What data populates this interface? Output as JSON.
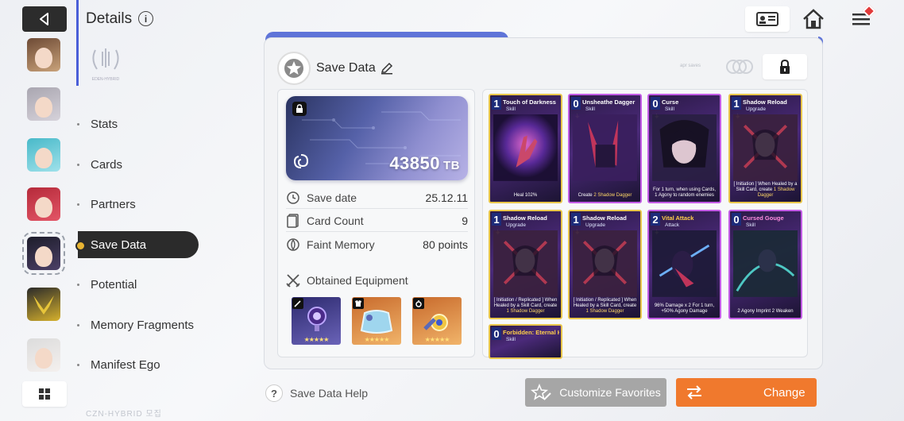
{
  "header": {
    "title": "Details",
    "info_icon": "i"
  },
  "emblem_text": "EDEN-HYBRID",
  "bottom_watermark": "CZN-HYBRID 모집",
  "nav": {
    "items": [
      {
        "label": "Stats"
      },
      {
        "label": "Cards"
      },
      {
        "label": "Partners"
      },
      {
        "label": "Save Data",
        "active": true
      },
      {
        "label": "Potential"
      },
      {
        "label": "Memory Fragments"
      },
      {
        "label": "Manifest Ego"
      }
    ]
  },
  "panel": {
    "title": "Save Data",
    "small_label": "apr saves"
  },
  "save_chip": {
    "value": "43850",
    "unit": "TB"
  },
  "stats": {
    "save_date": {
      "label": "Save date",
      "value": "25.12.11"
    },
    "card_count": {
      "label": "Card Count",
      "value": "9"
    },
    "faint_memory": {
      "label": "Faint Memory",
      "value": "80 points"
    }
  },
  "equipment": {
    "title": "Obtained Equipment",
    "items": [
      {
        "slot_icon": "sword-icon",
        "stars": "★★★★★"
      },
      {
        "slot_icon": "armor-icon",
        "stars": "★★★★★"
      },
      {
        "slot_icon": "ring-icon",
        "stars": "★★★★★"
      }
    ]
  },
  "cards": [
    {
      "cost": "1",
      "name": "Touch of Darkness",
      "type": "Skill",
      "desc": "Heal 102%"
    },
    {
      "cost": "0",
      "name": "Unsheathe Dagger",
      "type": "Skill",
      "desc_parts": [
        "Create ",
        "2 Shadow Dagger",
        ""
      ]
    },
    {
      "cost": "0",
      "name": "Curse",
      "type": "Skill",
      "desc": "For 1 turn, when using Cards, 1 Agony to random enemies"
    },
    {
      "cost": "1",
      "name": "Shadow Reload",
      "type": "Upgrade",
      "desc_parts": [
        "[ Initiation ] When Healed by a Skill Card, create ",
        "1 Shadow Dagger",
        ""
      ]
    },
    {
      "cost": "1",
      "name": "Shadow Reload",
      "type": "Upgrade",
      "desc_parts": [
        "[ Initiation / Replicated ] When Healed by a Skill Card, create ",
        "1 Shadow Dagger",
        ""
      ]
    },
    {
      "cost": "1",
      "name": "Shadow Reload",
      "type": "Upgrade",
      "desc_parts": [
        "[ Initiation / Replicated ] When Healed by a Skill Card, create ",
        "1 Shadow Dagger",
        ""
      ]
    },
    {
      "cost": "2",
      "name": "Vital Attack",
      "type": "Attack",
      "desc": "96% Damage x 2 For 1 turn, +50% Agony Damage"
    },
    {
      "cost": "0",
      "name": "Cursed Gouge",
      "type": "Skill",
      "desc": "2 Agony Imprint 2 Weaken"
    },
    {
      "cost": "0",
      "name": "Forbidden: Eternal Hunger",
      "type": "Skill",
      "desc": ""
    }
  ],
  "footer": {
    "help": "Save Data Help",
    "help_icon": "?",
    "favorites": "Customize Favorites",
    "change": "Change"
  },
  "colors": {
    "accent_blue": "#5f74d8",
    "change_orange": "#f0792d",
    "nav_active_bg": "#2b2b2b"
  }
}
